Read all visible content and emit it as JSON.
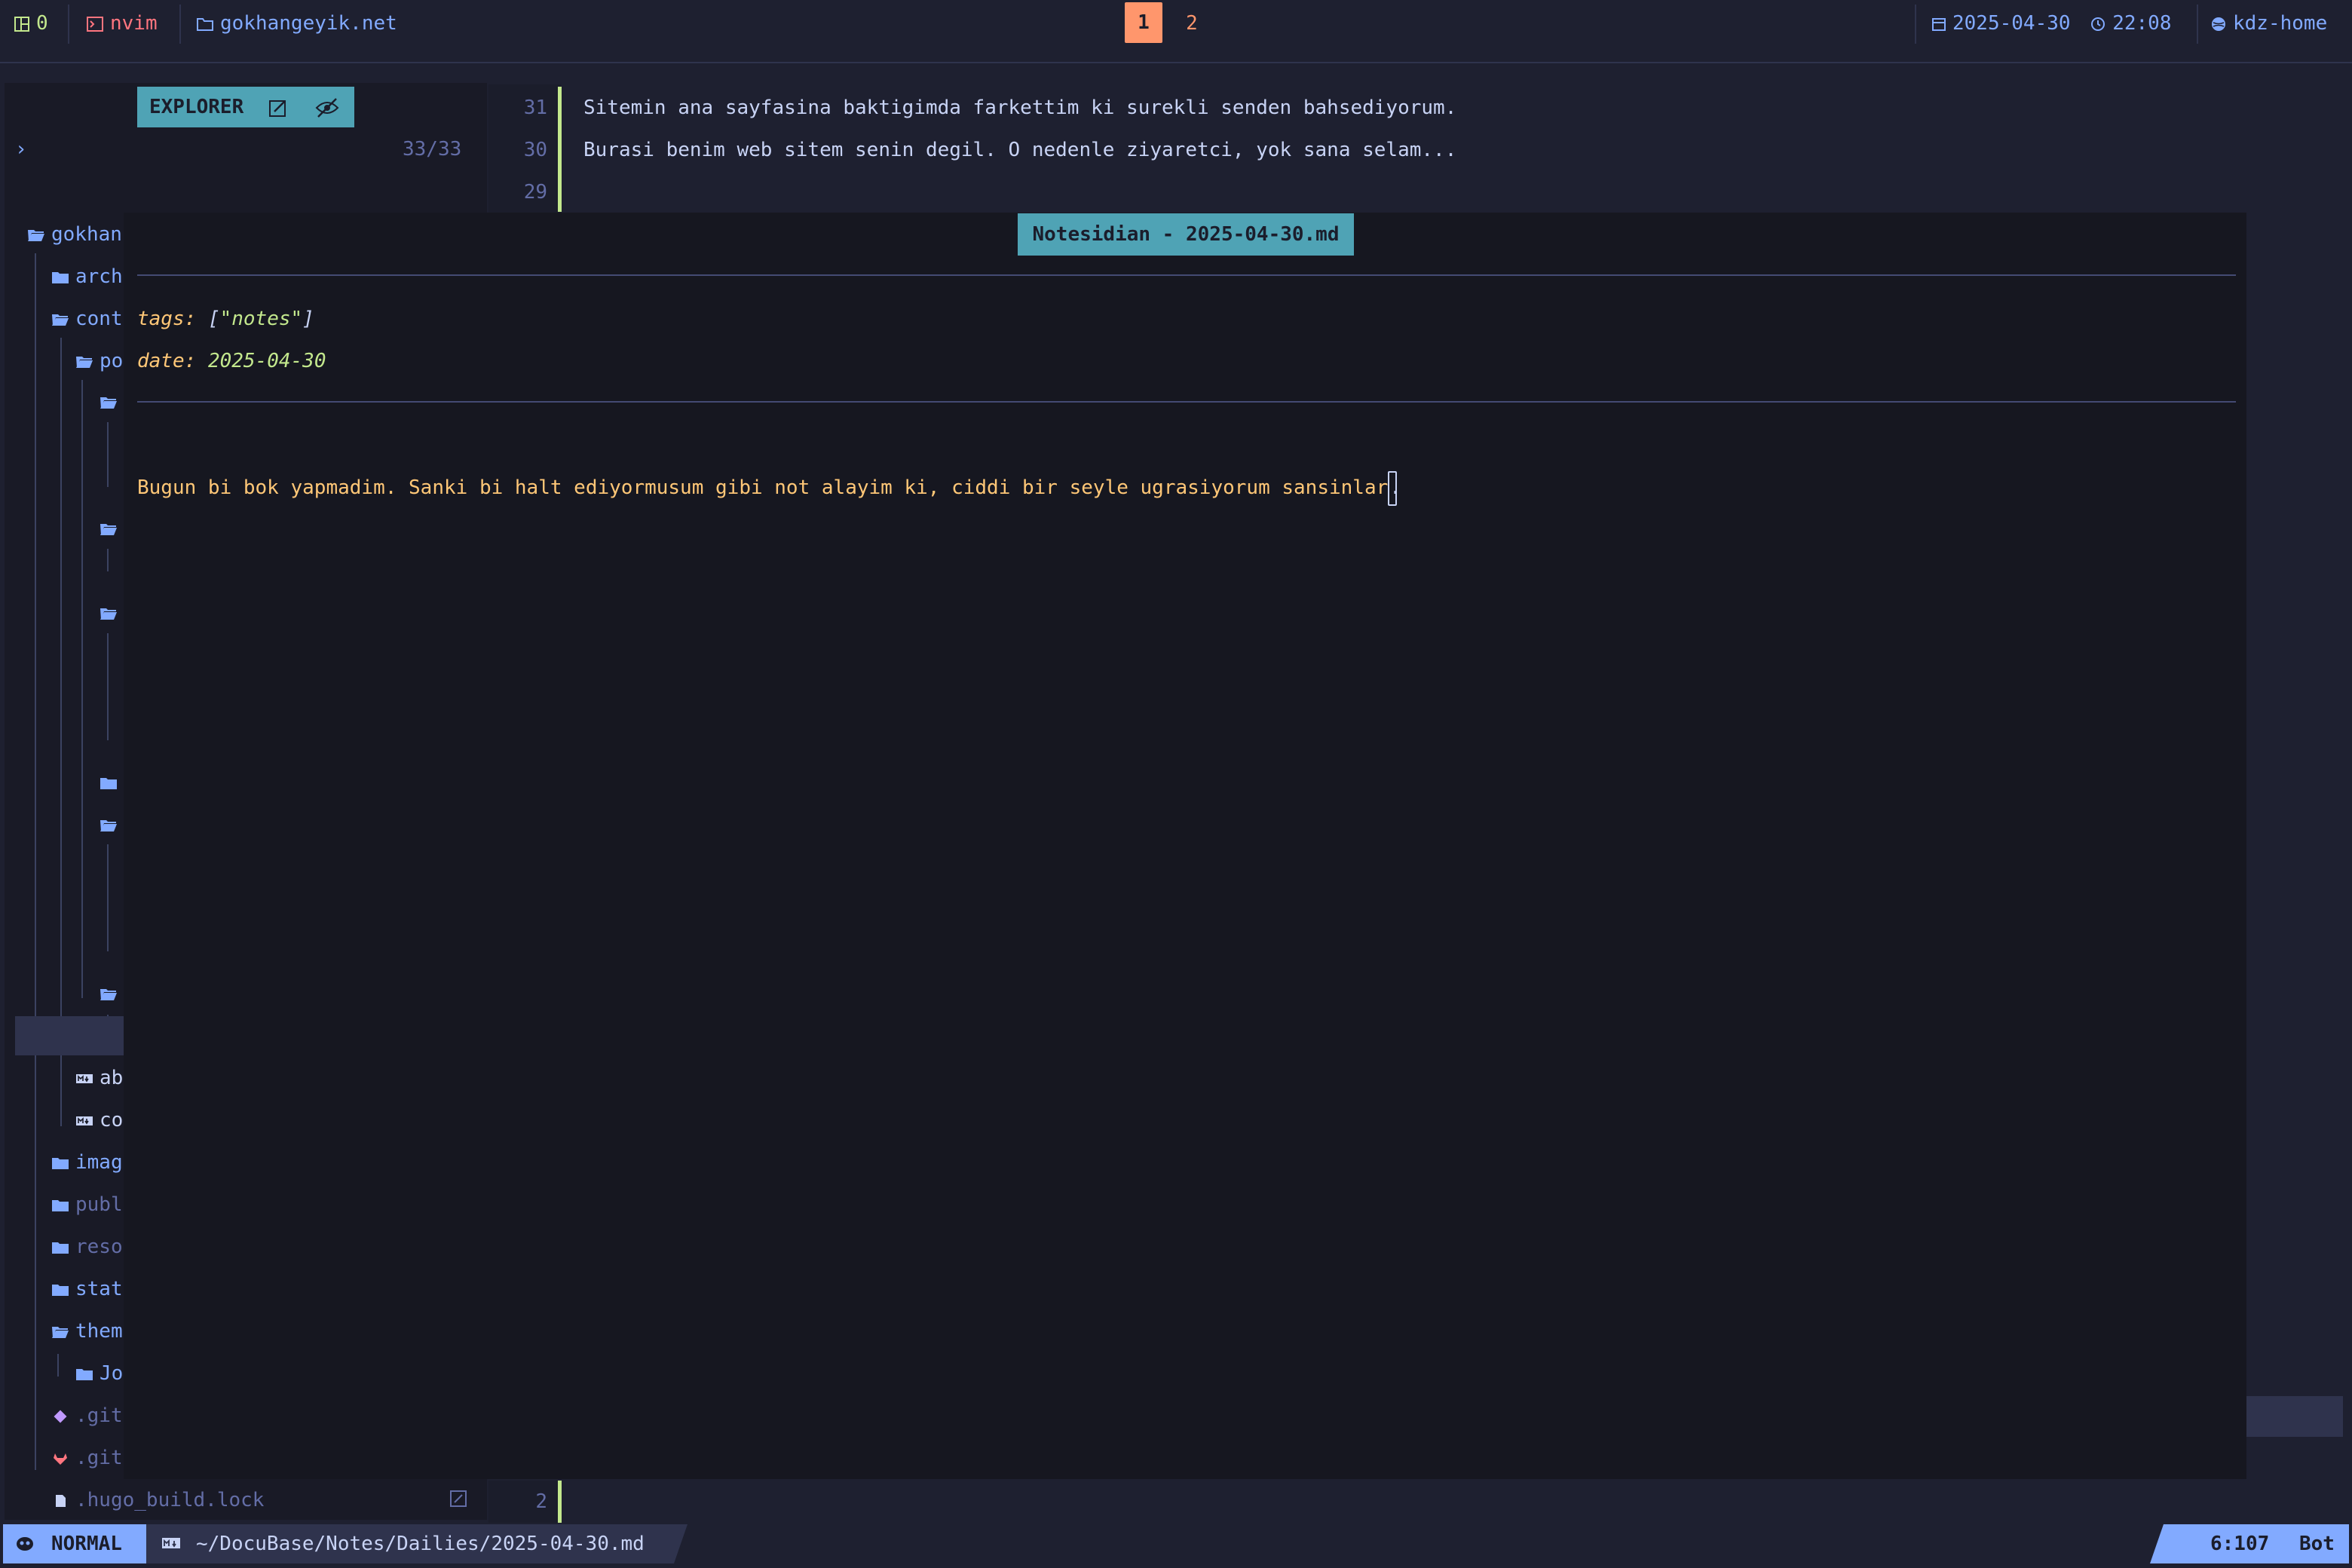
{
  "topbar": {
    "layout_count": "0",
    "app": "nvim",
    "project": "gokhangeyik.net",
    "workspaces": [
      "1",
      "2"
    ],
    "date": "2025-04-30",
    "time": "22:08",
    "host": "kdz-home"
  },
  "explorer": {
    "title": "EXPLORER",
    "count": "33/33",
    "prompt": "›",
    "tree": {
      "root": "gokhan",
      "arch": "arch",
      "cont": "cont",
      "po": "po",
      "ab": "ab",
      "co": "co",
      "imag": "imag",
      "publ": "publ",
      "reso": "reso",
      "stat": "stat",
      "them": "them",
      "jo": "Jo",
      "git1": ".git",
      "git2": ".git",
      "hugo": ".hugo_build.lock"
    }
  },
  "editor_top": {
    "lines": [
      {
        "num": "31",
        "text": "Sitemin ana sayfasina baktigimda farkettim ki surekli senden bahsediyorum."
      },
      {
        "num": "30",
        "text": "Burasi benim web sitem senin degil. O nedenle ziyaretci, yok sana selam..."
      },
      {
        "num": "29",
        "text": ""
      }
    ]
  },
  "float": {
    "title": "Notesidian - 2025-04-30.md",
    "tags_key": "tags:",
    "tags_open": "[",
    "tags_val": "\"notes\"",
    "tags_close": "]",
    "date_key": "date:",
    "date_val": "2025-04-30",
    "body": "Bugun bi bok yapmadim. Sanki bi halt ediyormusum gibi not alayim ki, ciddi bir seyle ugrasiyorum sansinlar",
    "cursor_char": "."
  },
  "editor_bottom": {
    "line_num": "2"
  },
  "statusline": {
    "mode": "NORMAL",
    "path": "~/DocuBase/Notes/Dailies/2025-04-30.md",
    "position": "6:107",
    "scroll": "Bot"
  },
  "colors": {
    "bg": "#1e2030",
    "accent_blue": "#82aaff",
    "accent_cyan": "#4fa3b5",
    "accent_orange": "#ff966c",
    "yellow": "#ffc777",
    "green": "#c3e88d"
  }
}
